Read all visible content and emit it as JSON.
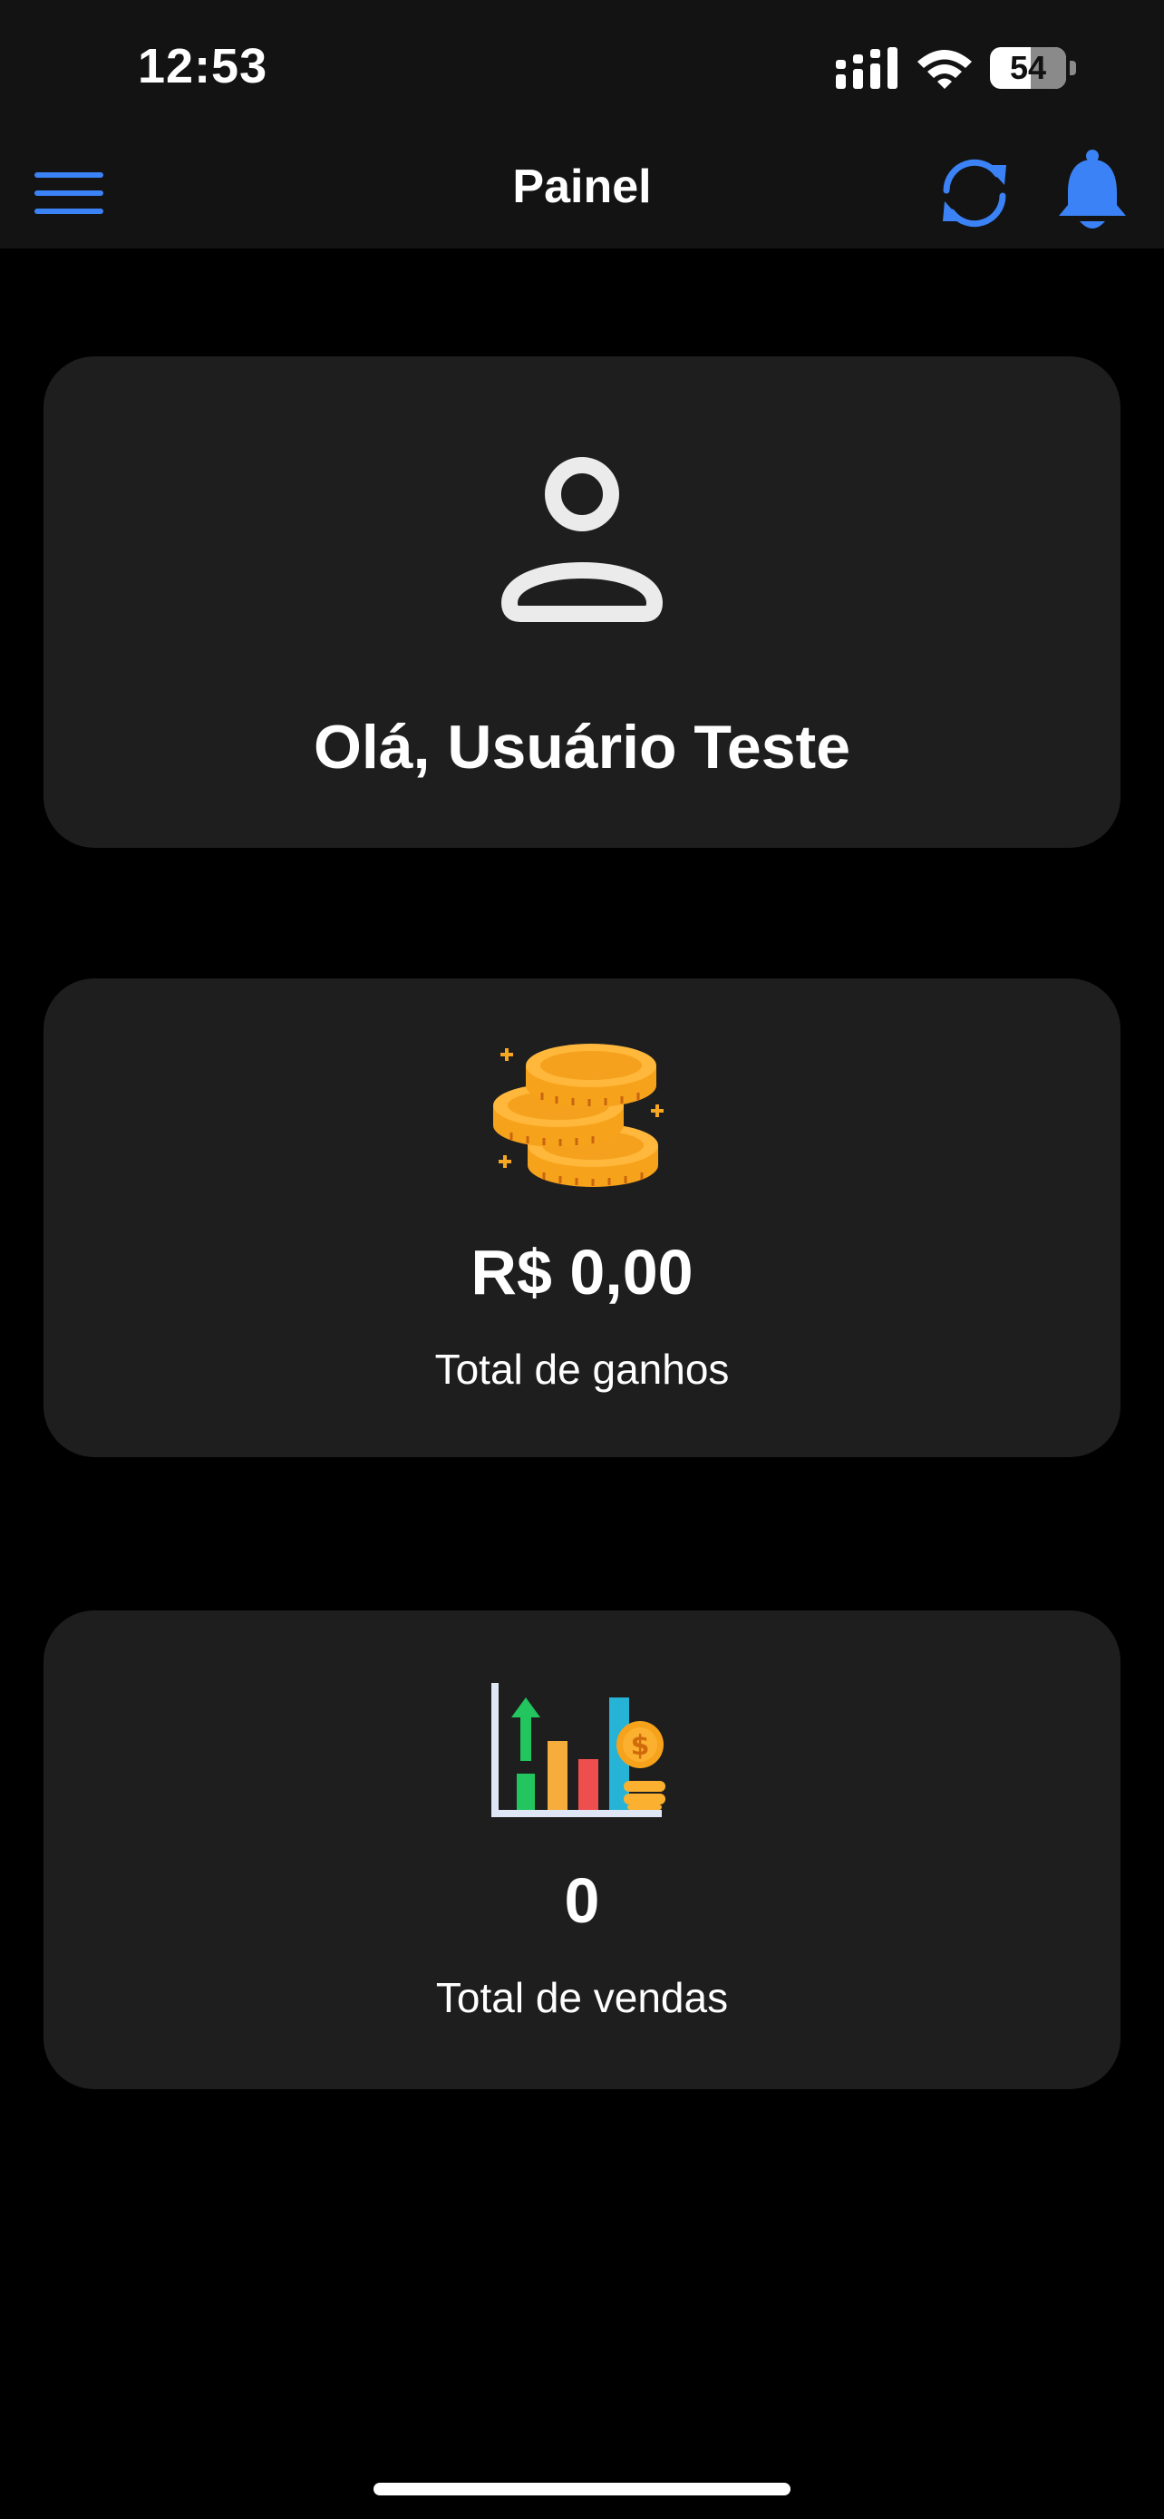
{
  "status_bar": {
    "time": "12:53",
    "battery": "54",
    "battery_level": 0.54
  },
  "header": {
    "title": "Painel",
    "menu_icon": "hamburger-menu-icon",
    "refresh_icon": "refresh-icon",
    "notifications_icon": "bell-icon",
    "accent_color": "#3b82f6"
  },
  "user_card": {
    "icon": "user-icon",
    "greeting": "Olá, Usuário Teste"
  },
  "earnings_card": {
    "icon": "coins-icon",
    "value": "R$ 0,00",
    "label": "Total de ganhos"
  },
  "sales_card": {
    "icon": "sales-chart-icon",
    "value": "0",
    "label": "Total de vendas"
  },
  "colors": {
    "background": "#000000",
    "header_background": "#131313",
    "card_background": "#1e1e1e",
    "text": "#ffffff"
  }
}
